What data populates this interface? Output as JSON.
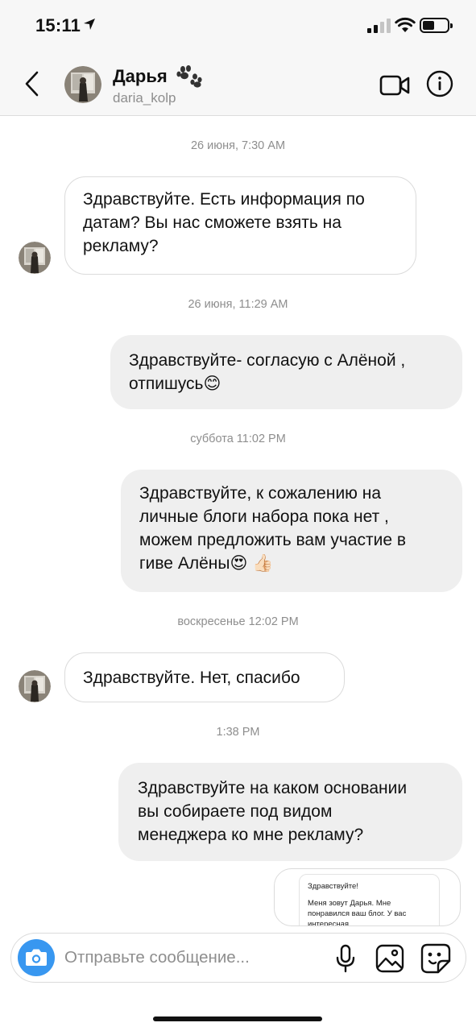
{
  "status_bar": {
    "time": "15:11"
  },
  "header": {
    "name": "Дарья",
    "username": "daria_kolp",
    "icons": {
      "back": "chevron-left-icon",
      "name_badge": "paw-icon",
      "video": "video-camera-icon",
      "info": "info-icon"
    }
  },
  "conversation": {
    "timestamps": [
      "26 июня, 7:30 AM",
      "26 июня, 11:29 AM",
      "суббота 11:02 PM",
      "воскресенье 12:02 PM",
      "1:38 PM"
    ],
    "messages": [
      {
        "direction": "in",
        "text": "Здравствуйте. Есть информация по\nдатам? Вы нас сможете взять на\nрекламу?"
      },
      {
        "direction": "out",
        "text": "Здравствуйте- согласую с Алёной ,\nотпишусь😊"
      },
      {
        "direction": "out",
        "text": "Здравствуйте, к сожалению на\nличные блоги набора пока нет ,\nможем предложить вам участие в\nгиве Алёны😍 👍🏻"
      },
      {
        "direction": "in",
        "text": "Здравствуйте. Нет, спасибо"
      },
      {
        "direction": "out",
        "text": "Здравствуйте на каком основании\nвы собираете под видом\nменеджера ко мне рекламу?"
      }
    ],
    "shared_preview": {
      "greeting": "Здравствуйте!",
      "body": "Меня зовут Дарья. Мне понравился ваш блог. У вас интересная"
    }
  },
  "composer": {
    "placeholder": "Отправьте сообщение...",
    "icons": {
      "camera": "camera-icon",
      "mic": "microphone-icon",
      "gallery": "image-icon",
      "sticker": "sticker-icon"
    }
  },
  "colors": {
    "accent": "#3897f0",
    "outgoing_bubble": "#efefef",
    "incoming_border": "#dbdbdb",
    "secondary_text": "#8e8e8e"
  }
}
